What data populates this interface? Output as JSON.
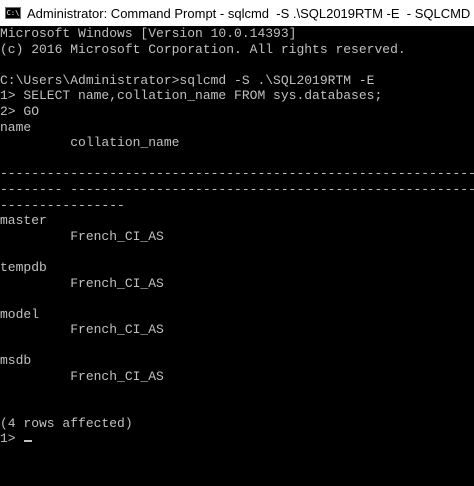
{
  "window": {
    "icon_glyph": "C:\\",
    "title": "Administrator: Command Prompt - sqlcmd  -S .\\SQL2019RTM -E  - SQLCMD"
  },
  "console": {
    "lines": [
      "Microsoft Windows [Version 10.0.14393]",
      "(c) 2016 Microsoft Corporation. All rights reserved.",
      "",
      "C:\\Users\\Administrator>sqlcmd -S .\\SQL2019RTM -E",
      "1> SELECT name,collation_name FROM sys.databases;",
      "2> GO",
      "name",
      "         collation_name",
      "",
      "---------------------------------------------------------------------",
      "-------- -----------------------------------------------------------",
      "----------------",
      "master",
      "         French_CI_AS",
      "",
      "tempdb",
      "         French_CI_AS",
      "",
      "model",
      "         French_CI_AS",
      "",
      "msdb",
      "         French_CI_AS",
      "",
      "",
      "(4 rows affected)"
    ],
    "prompt": "1> "
  }
}
